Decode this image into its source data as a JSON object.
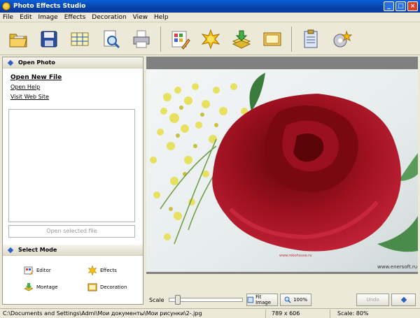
{
  "window": {
    "title": "Photo Effects Studio",
    "minimize": "_",
    "maximize": "□",
    "close": "×"
  },
  "menu": [
    "File",
    "Edit",
    "Image",
    "Effects",
    "Decoration",
    "View",
    "Help"
  ],
  "toolbar_icons": [
    "open-folder-icon",
    "save-disk-icon",
    "grid-icon",
    "preview-icon",
    "print-icon",
    "edit-grid-icon",
    "effects-sun-icon",
    "import-icon",
    "picture-icon",
    "clipboard-icon",
    "settings-icon"
  ],
  "left": {
    "open_photo": {
      "title": "Open Photo",
      "open_new_file": "Open New File",
      "open_help": "Open Help",
      "visit_web_site": "Visit Web Site",
      "open_selected": "Open selected file"
    },
    "select_mode": {
      "title": "Select Mode",
      "items": [
        "Editor",
        "Effects",
        "Montage",
        "Decoration"
      ]
    }
  },
  "viewer": {
    "watermark": "www.enersoft.ru"
  },
  "controls": {
    "scale_label": "Scale",
    "scale_fraction": 0.08,
    "fit_image": "Fit Image",
    "zoom_100": "100%",
    "undo": "Undo"
  },
  "status": {
    "path": "C:\\Documents and Settings\\Admi\\Мои документы\\Мои рисунки\\2-.jpg",
    "dimensions": "789 x 606",
    "scale": "Scale: 80%"
  },
  "colors": {
    "titlebar": "#0842a8",
    "accent": "#2d5fc4",
    "rose": "#9b1020"
  }
}
